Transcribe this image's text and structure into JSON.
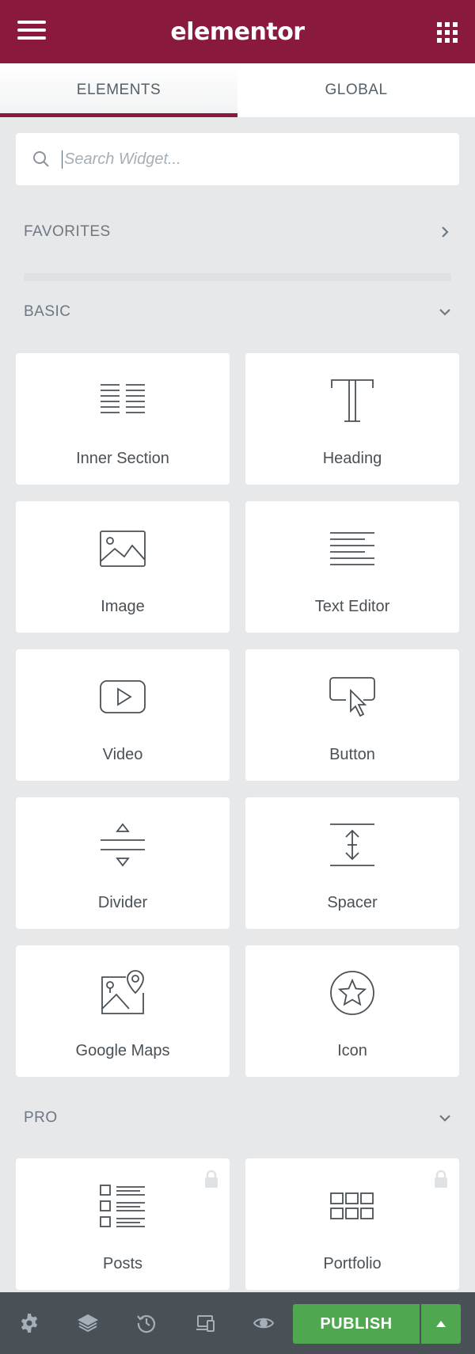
{
  "header": {
    "logo": "elementor",
    "menu_icon": "hamburger-menu-icon",
    "apps_icon": "grid-apps-icon",
    "color": "#8a1a3d"
  },
  "tabs": [
    {
      "label": "ELEMENTS",
      "active": true
    },
    {
      "label": "GLOBAL",
      "active": false
    }
  ],
  "search": {
    "placeholder": "Search Widget..."
  },
  "categories": {
    "favorites": {
      "label": "FAVORITES",
      "state": "collapsed"
    },
    "basic": {
      "label": "BASIC",
      "state": "expanded"
    },
    "pro": {
      "label": "PRO",
      "state": "expanded"
    }
  },
  "widgets": {
    "basic": [
      {
        "label": "Inner Section",
        "icon": "inner-section-icon"
      },
      {
        "label": "Heading",
        "icon": "heading-icon"
      },
      {
        "label": "Image",
        "icon": "image-icon"
      },
      {
        "label": "Text Editor",
        "icon": "text-editor-icon"
      },
      {
        "label": "Video",
        "icon": "video-icon"
      },
      {
        "label": "Button",
        "icon": "button-icon"
      },
      {
        "label": "Divider",
        "icon": "divider-icon"
      },
      {
        "label": "Spacer",
        "icon": "spacer-icon"
      },
      {
        "label": "Google Maps",
        "icon": "google-maps-icon"
      },
      {
        "label": "Icon",
        "icon": "star-icon"
      }
    ],
    "pro": [
      {
        "label": "Posts",
        "icon": "posts-icon",
        "locked": true
      },
      {
        "label": "Portfolio",
        "icon": "portfolio-icon",
        "locked": true
      }
    ]
  },
  "footer": {
    "icons": [
      "settings-icon",
      "navigator-layers-icon",
      "history-icon",
      "responsive-mode-icon",
      "preview-eye-icon"
    ],
    "publish_label": "PUBLISH",
    "publish_color": "#4fa74f"
  }
}
